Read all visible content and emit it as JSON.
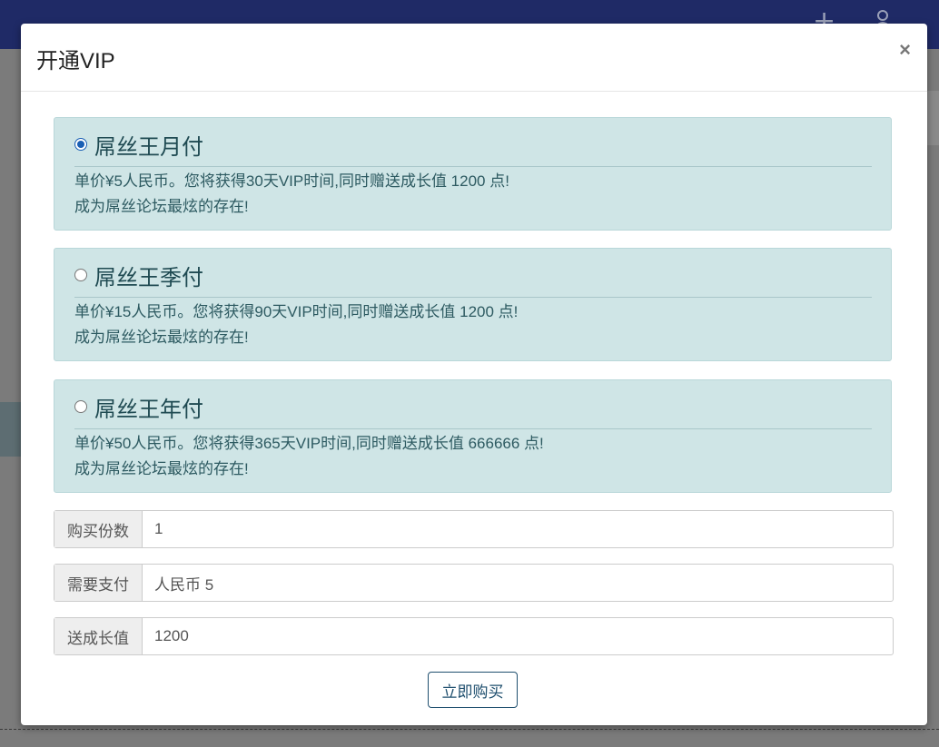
{
  "modal": {
    "title": "开通VIP",
    "close": "×"
  },
  "plans": [
    {
      "name": "屌丝王月付",
      "selected": true,
      "line1": "单价¥5人民币。您将获得30天VIP时间,同时赠送成长值 1200 点!",
      "line2": "成为屌丝论坛最炫的存在!"
    },
    {
      "name": "屌丝王季付",
      "selected": false,
      "line1": "单价¥15人民币。您将获得90天VIP时间,同时赠送成长值 1200 点!",
      "line2": "成为屌丝论坛最炫的存在!"
    },
    {
      "name": "屌丝王年付",
      "selected": false,
      "line1": "单价¥50人民币。您将获得365天VIP时间,同时赠送成长值 666666 点!",
      "line2": "成为屌丝论坛最炫的存在!"
    }
  ],
  "fields": {
    "quantity": {
      "label": "购买份数",
      "value": "1"
    },
    "payment": {
      "label": "需要支付",
      "value": "人民币 5"
    },
    "growth": {
      "label": "送成长值",
      "value": "1200"
    }
  },
  "buy_button": "立即购买",
  "background": {
    "topbar_plus": "+"
  },
  "colors": {
    "topbar": "#1f2a66",
    "plan_bg": "#cfe5e6",
    "plan_text": "#1f4a52",
    "radio_checked": "#1a5fb4",
    "button_border": "#1f4f6e"
  },
  "icons": [
    "plus-icon",
    "user-icon",
    "close-icon",
    "radio-checked-icon",
    "radio-unchecked-icon"
  ]
}
